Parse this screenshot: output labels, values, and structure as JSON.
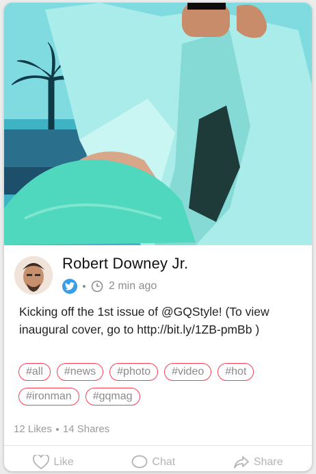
{
  "post": {
    "author_name": "Robert Downey Jr.",
    "source_icon": "twitter-icon",
    "time_ago": "2 min ago",
    "text": "Kicking off the 1st issue of @GQStyle! (To view inaugural cover, go to http://bit.ly/1ZB-pmBb )",
    "tags": [
      "#all",
      "#news",
      "#photo",
      "#video",
      "#hot",
      "#ironman",
      "#gqmag"
    ],
    "likes": "12 Likes",
    "shares": "14 Shares"
  },
  "actions": {
    "like_label": "Like",
    "chat_label": "Chat",
    "share_label": "Share"
  },
  "colors": {
    "tag_border": "#ff3b52",
    "twitter": "#3a9ee6",
    "hero_tint": "#62cfd6"
  }
}
